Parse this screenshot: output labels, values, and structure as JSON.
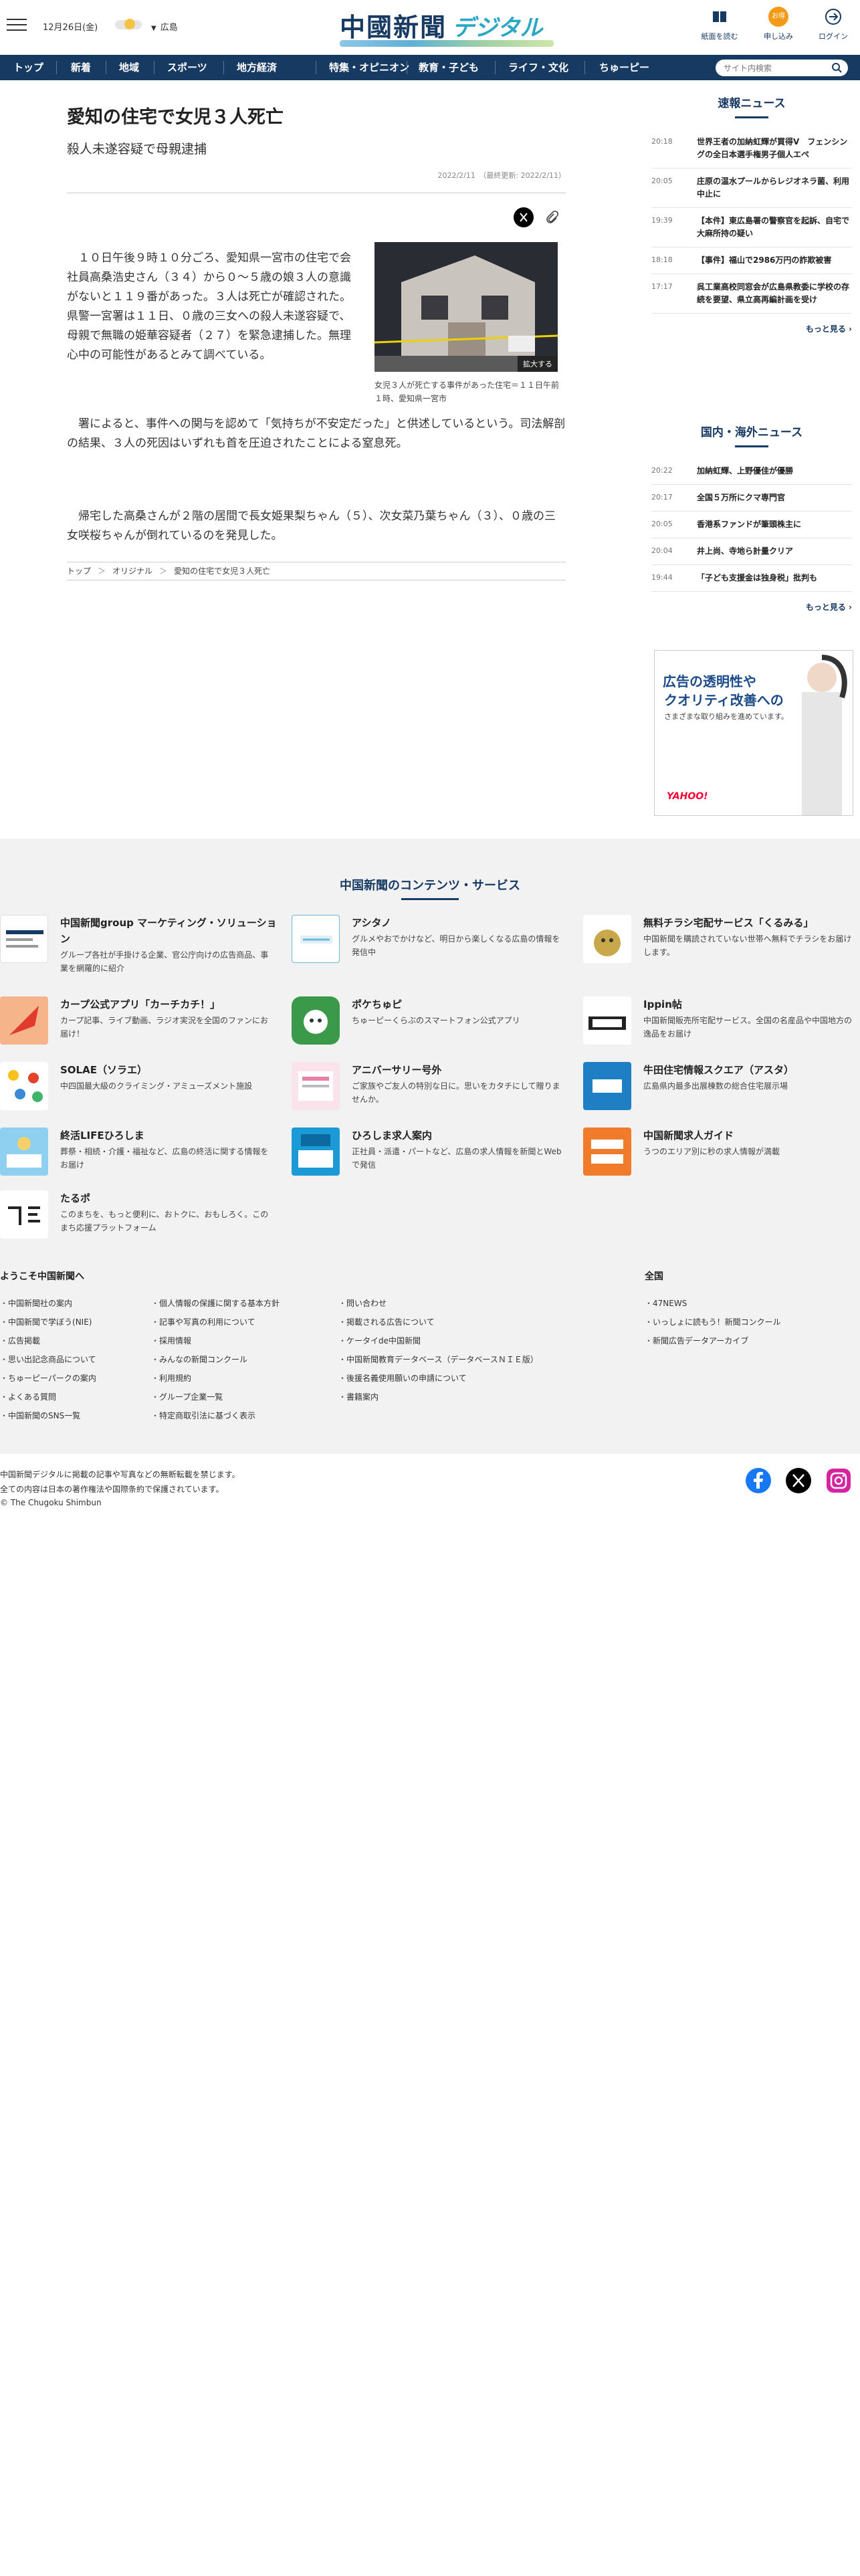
{
  "header": {
    "date": "12月26日(金)",
    "region": "広島",
    "logo_main": "中國新聞",
    "logo_sub": "デジタル",
    "buttons": [
      {
        "label": "紙面を読む"
      },
      {
        "label": "申し込み",
        "badge": "お得"
      },
      {
        "label": "ログイン"
      }
    ]
  },
  "nav": {
    "items": [
      "トップ",
      "新着",
      "地域",
      "スポーツ",
      "地方経済",
      "特集・オピニオン",
      "教育・子ども",
      "ライフ・文化",
      "ちゅーピー"
    ],
    "search_placeholder": "サイト内検索"
  },
  "article": {
    "title": "愛知の住宅で女児３人死亡",
    "subtitle": "殺人未遂容疑で母親逮捕",
    "date": "2022/2/11　（最終更新: 2022/2/11）",
    "photo_zoom": "拡大する",
    "photo_caption": "女児３人が死亡する事件があった住宅＝１１日午前１時、愛知県一宮市",
    "p1": "　１０日午後９時１０分ごろ、愛知県一宮市の住宅で会社員高桑浩史さん（３４）から０～５歳の娘３人の意識がないと１１９番があった。３人は死亡が確認された。県警一宮署は１１日、０歳の三女への殺人未遂容疑で、母親で無職の姫華容疑者（２７）を緊急逮捕した。無理心中の可能性があるとみて調べている。",
    "p2": "　署によると、事件への関与を認めて「気持ちが不安定だった」と供述しているという。司法解剖の結果、３人の死因はいずれも首を圧迫されたことによる窒息死。",
    "p3": "　帰宅した高桑さんが２階の居間で長女姫果梨ちゃん（５）、次女菜乃葉ちゃん（３）、０歳の三女咲桜ちゃんが倒れているのを発見した。",
    "breadcrumb": [
      "トップ",
      "オリジナル",
      "愛知の住宅で女児３人死亡"
    ]
  },
  "sidebar": {
    "breaking": {
      "title": "速報ニュース",
      "items": [
        {
          "time": "20:18",
          "headline": "世界王者の加納虹輝が買得V　フェンシングの全日本選手権男子個人エペ"
        },
        {
          "time": "20:05",
          "headline": "庄原の温水プールからレジオネラ菌、利用中止に"
        },
        {
          "time": "19:39",
          "headline": "【本件】東広島署の警察官を起訴、自宅で大麻所持の疑い"
        },
        {
          "time": "18:18",
          "headline": "【事件】福山で2986万円の詐欺被害"
        },
        {
          "time": "17:17",
          "headline": "呉工業高校同窓会が広島県教委に学校の存続を要望、県立高再編計画を受け"
        }
      ],
      "more": "もっと見る"
    },
    "national": {
      "title": "国内・海外ニュース",
      "items": [
        {
          "time": "20:22",
          "headline": "加納虹輝、上野優佳が優勝"
        },
        {
          "time": "20:17",
          "headline": "全国５万所にクマ専門官"
        },
        {
          "time": "20:05",
          "headline": "香港系ファンドが筆頭株主に"
        },
        {
          "time": "20:04",
          "headline": "井上尚、寺地ら計量クリア"
        },
        {
          "time": "19:44",
          "headline": "「子ども支援金は独身税」批判も"
        }
      ],
      "more": "もっと見る"
    },
    "ad": {
      "line1": "広告の透明性や",
      "line2": "クオリティ改善への",
      "line3": "さまざまな取り組みを進めています。",
      "brand": "YAHOO!"
    }
  },
  "services": {
    "title": "中国新聞のコンテンツ・サービス",
    "items": [
      {
        "name": "中国新聞group マーケティング・ソリューション",
        "desc": "グループ各社が手掛ける企業、官公庁向けの広告商品、事業を網羅的に紹介",
        "icon": "marketing-logo"
      },
      {
        "name": "アシタノ",
        "desc": "グルメやおでかけなど、明日から楽しくなる広島の情報を発信中",
        "icon": "ashitano-logo"
      },
      {
        "name": "無料チラシ宅配サービス「くるみる」",
        "desc": "中国新聞を購読されていない世帯へ無料でチラシをお届けします。",
        "icon": "kurumiru-logo"
      },
      {
        "name": "カープ公式アプリ「カーチカチ！」",
        "desc": "カープ記事、ライブ動画、ラジオ実況を全国のファンにお届け！",
        "icon": "carp-logo"
      },
      {
        "name": "ポケちゅピ",
        "desc": "ちゅーピーくらぶのスマートフォン公式アプリ",
        "icon": "pokechupi-logo"
      },
      {
        "name": "Ippin帖",
        "desc": "中国新聞販売所宅配サービス。全国の名産品や中国地方の逸品をお届け",
        "icon": "ippin-logo"
      },
      {
        "name": "SOLAE（ソラエ）",
        "desc": "中四国最大級のクライミング・アミューズメント施設",
        "icon": "solae-logo"
      },
      {
        "name": "アニバーサリー号外",
        "desc": "ご家族やご友人の特別な日に。思いをカタチにして贈りませんか。",
        "icon": "anniversary-logo"
      },
      {
        "name": "牛田住宅情報スクエア（アスタ）",
        "desc": "広島県内最多出展棟数の総合住宅展示場",
        "icon": "asta-logo"
      },
      {
        "name": "終活LIFEひろしま",
        "desc": "葬祭・相続・介護・福祉など、広島の終活に関する情報をお届け",
        "icon": "shukatsu-logo"
      },
      {
        "name": "ひろしま求人案内",
        "desc": "正社員・派遣・パートなど、広島の求人情報を新聞とWebで発信",
        "icon": "kyujin-logo"
      },
      {
        "name": "中国新聞求人ガイド",
        "desc": "うつのエリア別に秒の求人情報が満載",
        "icon": "kyujin-guide-logo"
      },
      {
        "name": "たるポ",
        "desc": "このまちを、もっと便利に、おトクに、おもしろく。このまち応援プラットフォーム",
        "icon": "taruporta-logo"
      }
    ]
  },
  "footer": {
    "welcome": "ようこそ中国新聞へ",
    "national": "全国",
    "col1": [
      "中国新聞社の案内",
      "中国新聞で学ぼう(NIE)",
      "広告掲載",
      "思い出記念商品について",
      "ちゅーピーパークの案内",
      "よくある質問",
      "中国新聞のSNS一覧"
    ],
    "col2": [
      "個人情報の保護に関する基本方針",
      "記事や写真の利用について",
      "採用情報",
      "みんなの新聞コンクール",
      "利用規約",
      "グループ企業一覧",
      "特定商取引法に基づく表示"
    ],
    "col3": [
      "問い合わせ",
      "掲載される広告について",
      "ケータイde中国新聞",
      "中国新聞教育データベース（データベースＮＩＥ版）",
      "後援名義使用願いの申請について",
      "書籍案内"
    ],
    "col4": [
      "47NEWS",
      "いっしょに読もう！新聞コンクール",
      "新聞広告データアーカイブ"
    ],
    "copyright": [
      "中国新聞デジタルに掲載の記事や写真などの無断転載を禁じます。",
      "全ての内容は日本の著作権法や国際条約で保護されています。",
      "© The Chugoku Shimbun"
    ]
  },
  "colors": {
    "brand_navy": "#173a63",
    "accent_orange": "#f39a16"
  }
}
